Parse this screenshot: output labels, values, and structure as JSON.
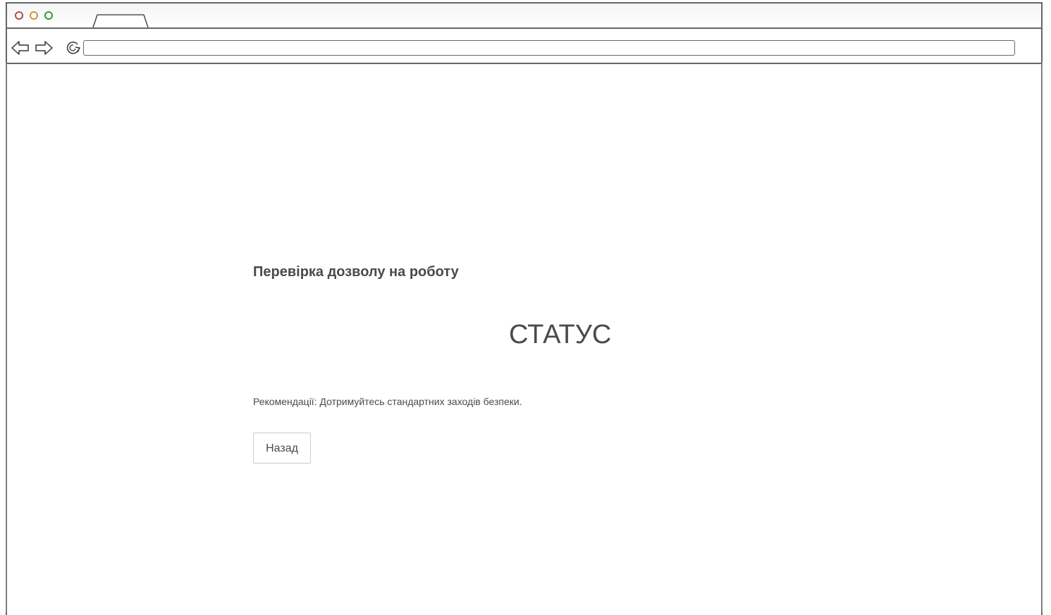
{
  "browser": {
    "tab_title": "",
    "address": ""
  },
  "main": {
    "title": "Перевірка дозволу на роботу",
    "status": "СТАТУС",
    "recommendation": "Рекомендації: Дотримуйтесь стандартних заходів безпеки.",
    "back_button_label": "Назад"
  },
  "icons": {
    "back": "arrow-left-icon",
    "forward": "arrow-right-icon",
    "reload": "reload-icon"
  },
  "colors": {
    "close": "#b54b4b",
    "minimize": "#d7923a",
    "maximize": "#2f9b3a",
    "text": "#4a4a4a",
    "frame": "#666666"
  }
}
